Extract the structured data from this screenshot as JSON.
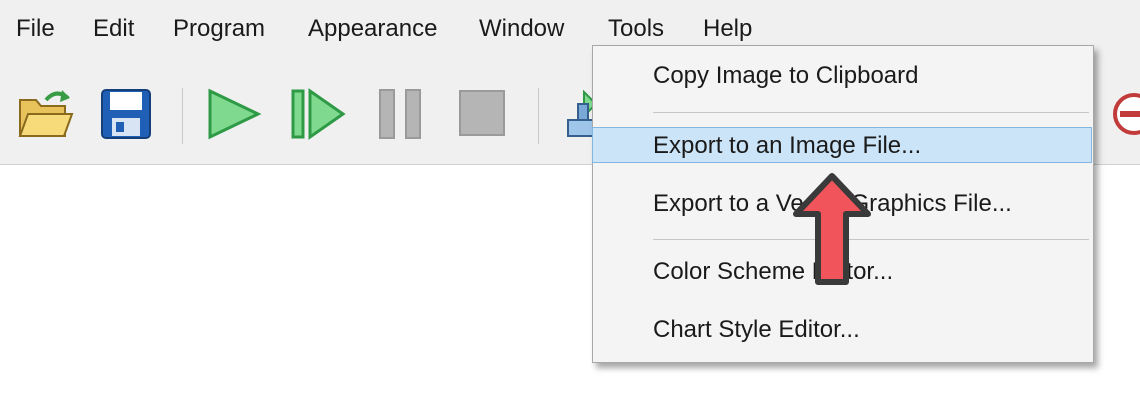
{
  "menubar": {
    "items": [
      "File",
      "Edit",
      "Program",
      "Appearance",
      "Window",
      "Tools",
      "Help"
    ]
  },
  "toolbar": {
    "buttons": [
      {
        "icon": "open-folder-icon"
      },
      {
        "icon": "save-icon"
      },
      {
        "icon": "run-icon"
      },
      {
        "icon": "step-icon"
      },
      {
        "icon": "pause-icon"
      },
      {
        "icon": "stop-icon"
      },
      {
        "icon": "chart-tool-icon"
      },
      {
        "icon": "cancel-icon"
      }
    ]
  },
  "tools_menu": {
    "items": [
      {
        "label": "Copy Image to Clipboard",
        "highlighted": false
      },
      {
        "label": "Export to an Image File...",
        "highlighted": true
      },
      {
        "label": "Export to a Vector Graphics File...",
        "highlighted": false
      },
      {
        "label": "Color Scheme Editor...",
        "highlighted": false
      },
      {
        "label": "Chart Style Editor...",
        "highlighted": false
      }
    ]
  },
  "colors": {
    "highlight_bg": "#cce4f7",
    "highlight_border": "#84b6e3",
    "annotation_arrow": "#f2545b",
    "run_green": "#7fd98f"
  }
}
